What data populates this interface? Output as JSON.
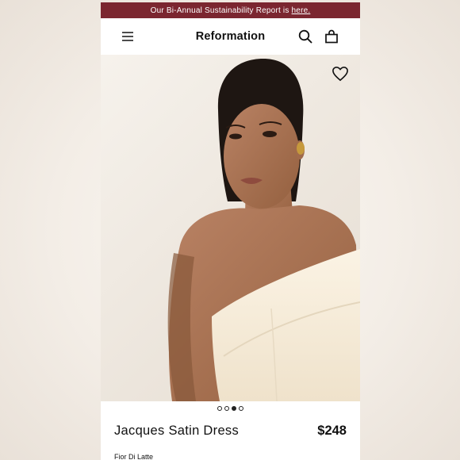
{
  "banner": {
    "text": "Our Bi-Annual Sustainability Report is",
    "link": "here.",
    "background": "#7b2630"
  },
  "header": {
    "brand": "Reformation",
    "icons": [
      "menu-icon",
      "search-icon",
      "shopping-bag-icon"
    ]
  },
  "gallery": {
    "wishlist_icon": "heart-icon",
    "image_count": 4,
    "active_index": 2
  },
  "product": {
    "name": "Jacques Satin Dress",
    "price": "$248",
    "color": "Fior Di Latte"
  }
}
